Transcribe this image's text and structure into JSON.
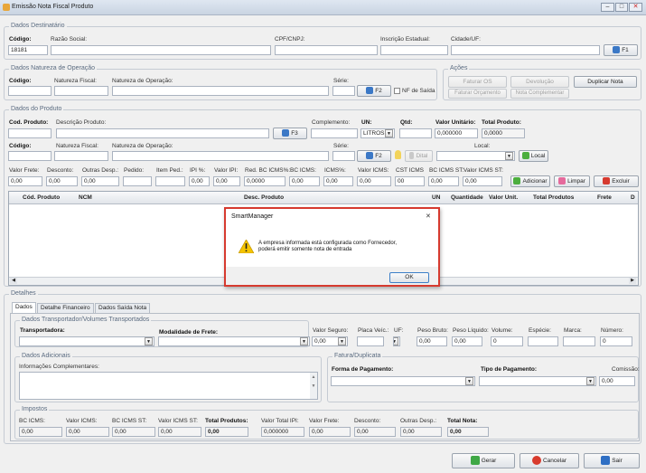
{
  "window": {
    "title": "Emissão Nota Fiscal Produto",
    "min": "–",
    "max": "□",
    "close": "✕"
  },
  "dest": {
    "legend": "Dados Destinatário",
    "codigo_label": "Código:",
    "razao_label": "Razão Social:",
    "cpf_label": "CPF/CNPJ:",
    "ie_label": "Inscrição Estadual:",
    "cidade_label": "Cidade/UF:",
    "codigo_value": "18181",
    "f1": "F1"
  },
  "natureza": {
    "legend": "Dados Natureza de Operação",
    "codigo_label": "Código:",
    "fiscal_label": "Natureza Fiscal:",
    "operacao_label": "Natureza de Operação:",
    "serie_label": "Série:",
    "f2": "F2",
    "nf_saida": "NF de Saída"
  },
  "acoes": {
    "legend": "Ações",
    "faturar_os": "Faturar OS",
    "devolucao": "Devolução",
    "duplicar": "Duplicar Nota",
    "faturar_orc": "Faturar Orçamento",
    "complementar": "Nota Complementar"
  },
  "produto": {
    "legend": "Dados do Produto",
    "cod_label": "Cod. Produto:",
    "desc_label": "Descrição Produto:",
    "f3": "F3",
    "complemento_label": "Complemento:",
    "un_label": "UN:",
    "un_value": "LITROS",
    "qtd_label": "Qtd:",
    "vunit_label": "Valor Unitário:",
    "vunit_value": "0,000000",
    "total_label": "Total Produto:",
    "total_value": "0,0000",
    "codigo2_label": "Código:",
    "fiscal_label": "Natureza Fiscal:",
    "operacao_label": "Natureza de Operação:",
    "serie_label": "Série:",
    "f2": "F2",
    "dital": "Dital",
    "local_label": "Local:",
    "local_btn": "Local",
    "row_labels": [
      "Valor Frete:",
      "Desconto:",
      "Outras Desp.:",
      "Pedido:",
      "Item Ped.:",
      "IPI %:",
      "Valor IPI:",
      "Red. BC ICMS%:",
      "BC ICMS:",
      "ICMS%:",
      "Valor ICMS:",
      "CST ICMS",
      "BC ICMS ST:",
      "Valor ICMS ST:"
    ],
    "row_values": [
      "0,00",
      "0,00",
      "0,00",
      "",
      "",
      "0,00",
      "0,00",
      "0,0000",
      "0,00",
      "0,00",
      "0,00",
      "00",
      "0,00",
      "0,00"
    ],
    "adicionar": "Adicionar",
    "limpar": "Limpar",
    "excluir": "Excluir"
  },
  "grid": {
    "columns": [
      "Cód. Produto",
      "NCM",
      "Desc. Produto",
      "UN",
      "Quantidade",
      "Valor Unit.",
      "Total Produtos",
      "Frete",
      "D"
    ]
  },
  "dialog": {
    "title": "SmartManager",
    "close": "✕",
    "message_line1": "A empresa informada está configurada como Fornecedor,",
    "message_line2": "poderá emitir somente nota de entrada",
    "ok": "OK"
  },
  "detalhes": {
    "legend": "Detalhes",
    "tabs": [
      "Dados",
      "Detalhe Financeiro",
      "Dados Saída Nota"
    ],
    "transp": {
      "legend": "Dados Transportador/Volumes Transportados",
      "transportadora": "Transportadora:",
      "modalidade": "Modalidade de Frete:",
      "labels": [
        "Valor Seguro:",
        "Placa Veíc.:",
        "UF:",
        "Peso Bruto:",
        "Peso Líquido:",
        "Volume:",
        "Espécie:",
        "Marca:",
        "Número:"
      ],
      "values": [
        "0,00",
        "",
        "",
        "0,00",
        "0,00",
        "0",
        "",
        "",
        "0"
      ]
    },
    "adic": {
      "legend": "Dados Adicionais",
      "info_label": "Informações Complementares:"
    },
    "fatura": {
      "legend": "Fatura/Duplicata",
      "forma": "Forma de Pagamento:",
      "tipo": "Tipo de Pagamento:",
      "comissao": "Comissão:",
      "comissao_value": "0,00"
    },
    "impostos": {
      "legend": "Impostos",
      "labels": [
        "BC ICMS:",
        "Valor ICMS:",
        "BC ICMS ST:",
        "Valor ICMS ST:",
        "Total Produtos:",
        "Valor Total IPI:",
        "Valor Frete:",
        "Desconto:",
        "Outras Desp.:",
        "Total Nota:"
      ],
      "values": [
        "0,00",
        "0,00",
        "0,00",
        "0,00",
        "0,00",
        "0,000000",
        "0,00",
        "0,00",
        "0,00",
        "0,00"
      ]
    }
  },
  "footer": {
    "gerar": "Gerar",
    "cancelar": "Cancelar",
    "sair": "Sair"
  }
}
